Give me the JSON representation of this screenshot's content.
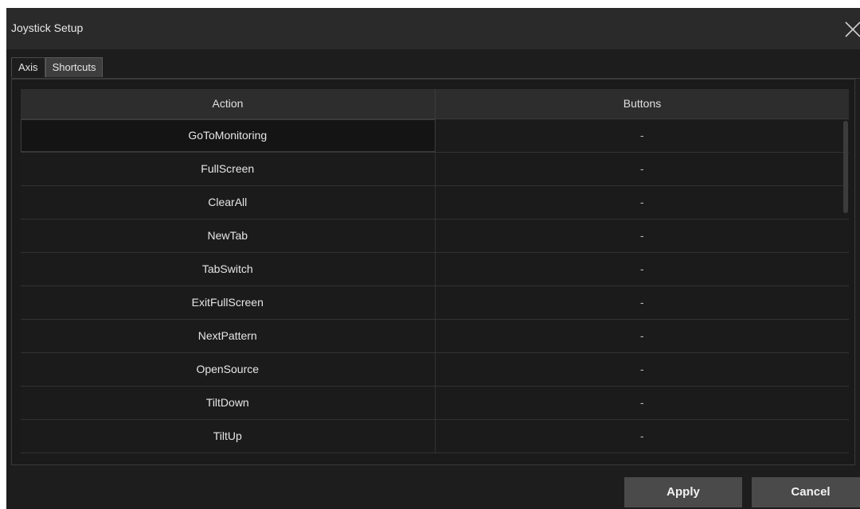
{
  "window": {
    "title": "Joystick Setup"
  },
  "tabs": [
    {
      "label": "Axis",
      "active": false
    },
    {
      "label": "Shortcuts",
      "active": true
    }
  ],
  "table": {
    "columns": [
      "Action",
      "Buttons"
    ],
    "rows": [
      {
        "action": "GoToMonitoring",
        "buttons": "-"
      },
      {
        "action": "FullScreen",
        "buttons": "-"
      },
      {
        "action": "ClearAll",
        "buttons": "-"
      },
      {
        "action": "NewTab",
        "buttons": "-"
      },
      {
        "action": "TabSwitch",
        "buttons": "-"
      },
      {
        "action": "ExitFullScreen",
        "buttons": "-"
      },
      {
        "action": "NextPattern",
        "buttons": "-"
      },
      {
        "action": "OpenSource",
        "buttons": "-"
      },
      {
        "action": "TiltDown",
        "buttons": "-"
      },
      {
        "action": "TiltUp",
        "buttons": "-"
      }
    ]
  },
  "footer": {
    "apply_label": "Apply",
    "cancel_label": "Cancel"
  },
  "icons": {
    "close": "close-icon"
  },
  "colors": {
    "background": "#1d1d1d",
    "titlebar": "#2a2a2a",
    "button": "#4a4a4a",
    "text": "#e6e6e6"
  }
}
